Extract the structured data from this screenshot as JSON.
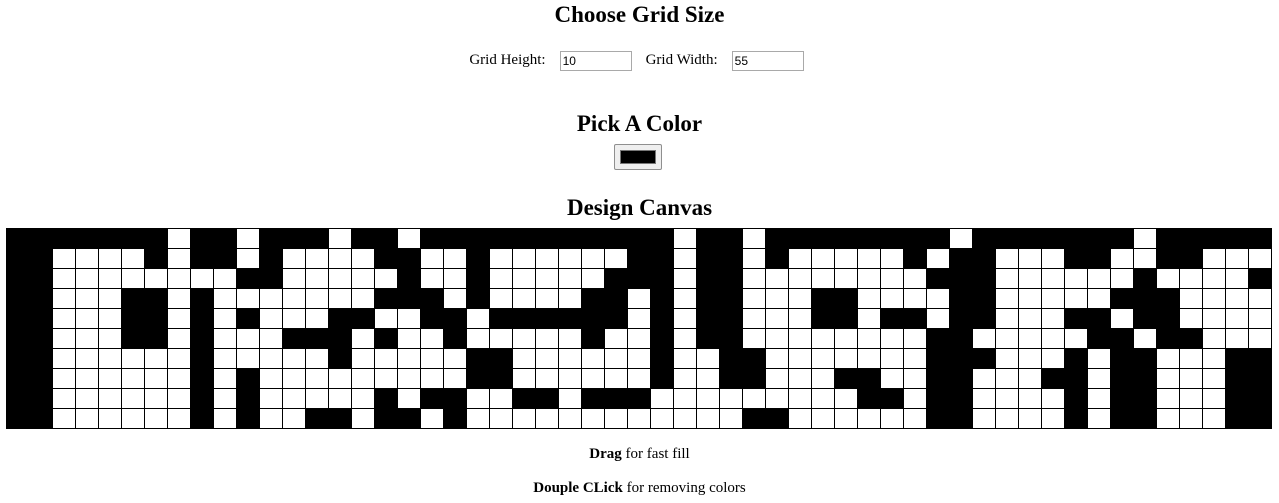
{
  "sections": {
    "grid_title": "Choose Grid Size",
    "color_title": "Pick A Color",
    "canvas_title": "Design Canvas"
  },
  "grid_form": {
    "height_label": "Grid Height:",
    "height_value": "10",
    "width_label": "Grid Width:",
    "width_value": "55"
  },
  "color_picker": {
    "value": "#000000"
  },
  "canvas": {
    "rows": 10,
    "cols": 55,
    "fill_color": "#000000",
    "empty_color": "#ffffff",
    "pixels": [
      "#######X##X###X##X###########X##X########X#######X#####",
      "##XXXX#X##X#XXXX##XX#XXXXXX##X##X#XXXXX#X##XXX##XX##XXX",
      "##XXXXXXXX##XXXXX#XX#XXXXX###X##XXXXXXXX###XXXXXX#XXXX",
      "##XXX##X#XXXXXXX###X#XXXX##X#X##XXX##XXXX##XXXXX###XXXX",
      "##XXX##X#X#XXX##XX##X######X#X##XXX##X##X##XXX##X##XXXX",
      "##XXX##X#XXX###X#XX#XXXXX#XX#X##XXXXXXXX##XXXXX##X##XXX",
      "##XXXXXX#XXXXX#XXXXX##XXXXXX#XX##XXXXXXX###XXX#X##XXX##",
      "##XXXXXX#X#XXXXXXXXX##XXXXXX#XX##XXX##XX##XXX##X##XXX##",
      "##XXXXXX#X#XXXXX#X##XX##X###XXXXXXXXX##X##XXXX#X##XXX##",
      "##XXXXXX#X#XX##X##X#XXXXXXXXXXXX##XXXXXX##XXXX#X##XXX##"
    ]
  },
  "hints": {
    "drag_bold": "Drag",
    "drag_rest": " for fast fill",
    "dbl_bold": "Douple CLick",
    "dbl_rest": " for removing colors"
  }
}
